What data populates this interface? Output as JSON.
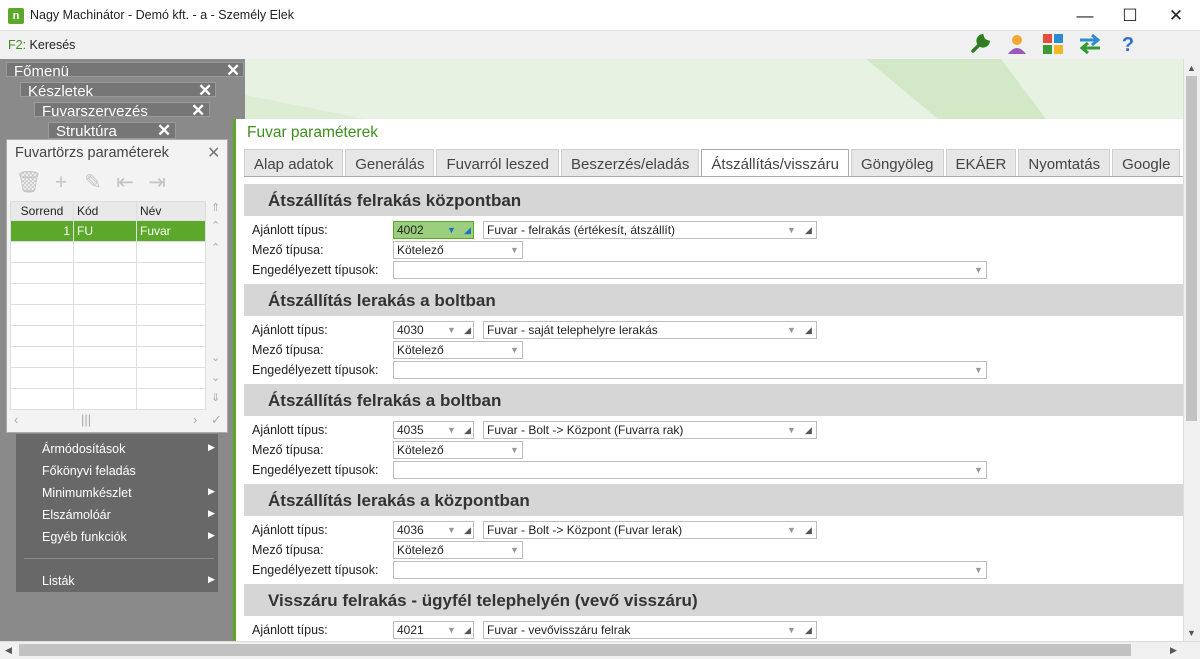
{
  "window": {
    "title": "Nagy Machinátor - Demó kft. - a - Személy Elek",
    "min": "—",
    "max": "☐",
    "close": "✕"
  },
  "toolbar": {
    "key": "F2:",
    "search_label": "Keresés"
  },
  "menus": {
    "fomenu": "Főmenü",
    "keszletek": "Készletek",
    "fuvarszervezes": "Fuvarszervezés",
    "struktura": "Struktúra",
    "items": [
      "Ármódosítások",
      "Főkönyvi feladás",
      "Minimumkészlet",
      "Elszámolóár",
      "Egyéb funkciók",
      "Listák"
    ]
  },
  "fuvartorzs": {
    "title": "Fuvartörzs paraméterek",
    "columns": [
      "Sorrend",
      "Kód",
      "Név"
    ],
    "rows": [
      {
        "order": "1",
        "code": "FU",
        "name": "Fuvar"
      }
    ]
  },
  "content": {
    "title": "Fuvar paraméterek",
    "tabs": [
      "Alap adatok",
      "Generálás",
      "Fuvarról leszed",
      "Beszerzés/eladás",
      "Átszállítás/visszáru",
      "Göngyöleg",
      "EKÁER",
      "Nyomtatás",
      "Google"
    ],
    "labels": {
      "type": "Ajánlott típus:",
      "field": "Mező típusa:",
      "allowed": "Engedélyezett típusok:"
    },
    "sections": [
      {
        "title": "Átszállítás felrakás központban",
        "code": "4002",
        "desc": "Fuvar - felrakás (értékesít, átszállít)",
        "mode": "Kötelező"
      },
      {
        "title": "Átszállítás lerakás a boltban",
        "code": "4030",
        "desc": "Fuvar - saját telephelyre lerakás",
        "mode": "Kötelező"
      },
      {
        "title": "Átszállítás felrakás a boltban",
        "code": "4035",
        "desc": "Fuvar - Bolt -> Központ (Fuvarra rak)",
        "mode": "Kötelező"
      },
      {
        "title": "Átszállítás lerakás a központban",
        "code": "4036",
        "desc": "Fuvar - Bolt -> Központ (Fuvar lerak)",
        "mode": "Kötelező"
      },
      {
        "title": "Visszáru felrakás - ügyfél telephelyén (vevő visszáru)",
        "code": "4021",
        "desc": "Fuvar - vevővisszáru felrak"
      }
    ]
  },
  "colors": {
    "accent": "#5ba82a",
    "title_green": "#3e8e1e",
    "blue": "#1a73c5"
  }
}
